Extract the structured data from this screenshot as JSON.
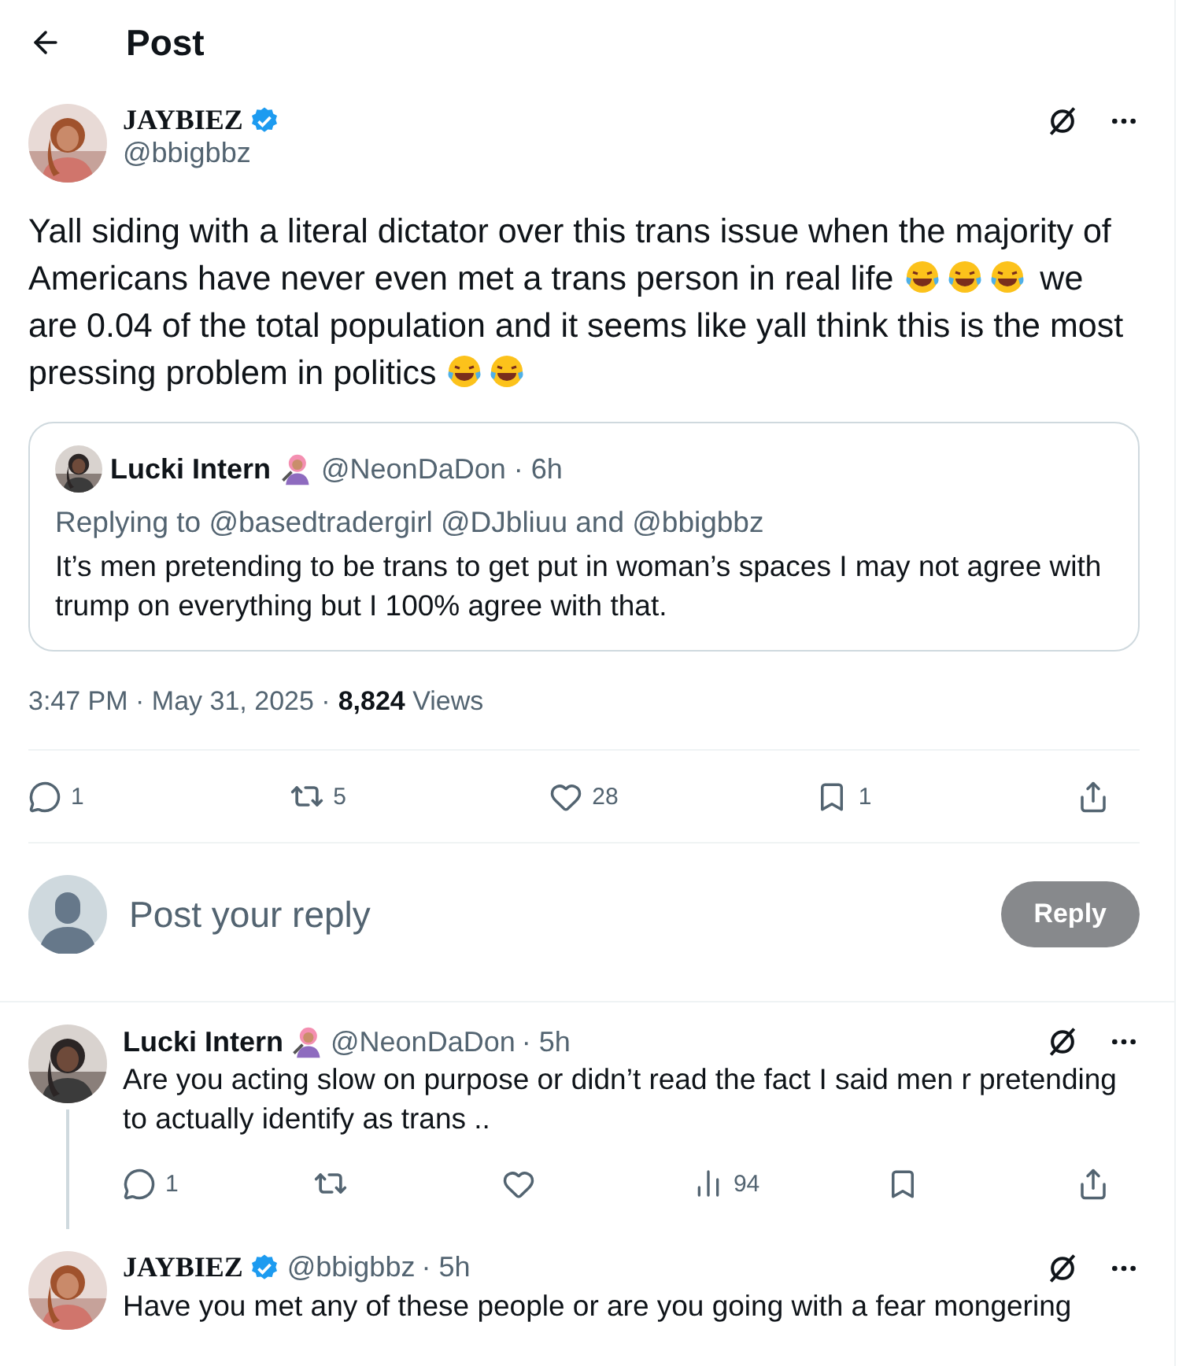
{
  "header": {
    "title": "Post"
  },
  "post": {
    "author": {
      "name": "JAYBIEZ",
      "handle": "@bbigbbz",
      "verified": true
    },
    "body": [
      {
        "kind": "text",
        "text": "Yall siding with a literal dictator over this trans issue when the majority of Americans have never even met a trans person in real life "
      },
      {
        "kind": "emoji"
      },
      {
        "kind": "emoji"
      },
      {
        "kind": "emoji"
      },
      {
        "kind": "text",
        "text": " we are 0.04 of the total population and it seems like yall think this is the most pressing problem in politics "
      },
      {
        "kind": "emoji"
      },
      {
        "kind": "emoji"
      }
    ],
    "quote": {
      "name": "Lucki Intern",
      "handle": "@NeonDaDon",
      "time": "· 6h",
      "name_emoji": true,
      "replying_to": "Replying to @basedtradergirl @DJbliuu and @bbigbbz",
      "text": "It’s men pretending to be trans to get put in woman’s spaces I may not agree with trump on everything but I 100% agree with that."
    },
    "meta": {
      "timestamp": "3:47 PM · May 31, 2025 ·",
      "views": "8,824",
      "views_label": "Views"
    },
    "actions": [
      {
        "kind": "reply",
        "count": "1"
      },
      {
        "kind": "repost",
        "count": "5"
      },
      {
        "kind": "like",
        "count": "28"
      },
      {
        "kind": "bookmark",
        "count": "1"
      },
      {
        "kind": "share"
      }
    ]
  },
  "composer": {
    "placeholder": "Post your reply",
    "button": "Reply",
    "disabled": true
  },
  "replies": [
    {
      "name": "Lucki Intern",
      "handle": "@NeonDaDon",
      "time": "· 5h",
      "verified": false,
      "name_emoji": true,
      "thread_line": true,
      "body": "Are you acting slow on purpose or didn’t read the fact I said men r pretending to actually identify as trans ..",
      "actions": [
        {
          "kind": "reply",
          "count": "1"
        },
        {
          "kind": "repost"
        },
        {
          "kind": "like"
        },
        {
          "kind": "views",
          "count": "94"
        },
        {
          "kind": "bookmark"
        },
        {
          "kind": "share"
        }
      ]
    },
    {
      "name": "JAYBIEZ",
      "handle": "@bbigbbz",
      "time": "· 5h",
      "verified": true,
      "name_emoji": false,
      "thread_line": false,
      "body": "Have you met any of these people or are you going with a fear mongering"
    }
  ]
}
